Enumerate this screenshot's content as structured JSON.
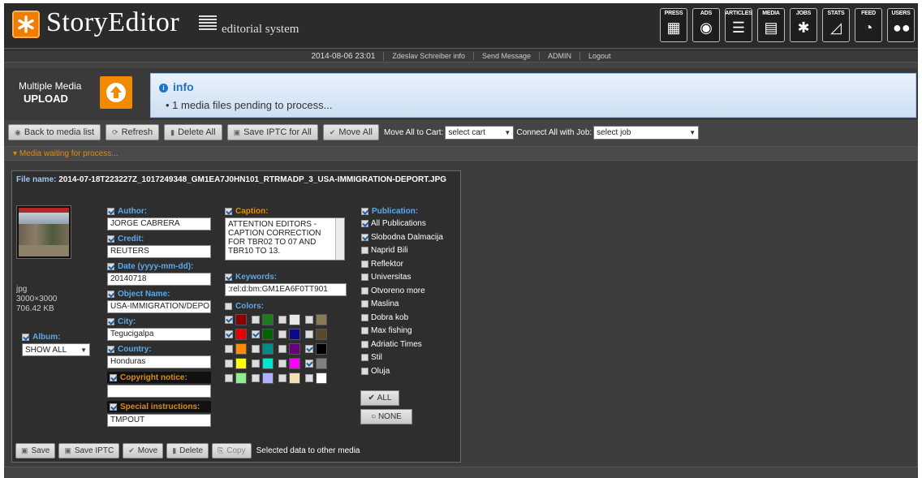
{
  "header": {
    "title": "StoryEditor",
    "subtitle": "editorial system",
    "nav": [
      {
        "label": "PRESS",
        "icon": "grid-icon"
      },
      {
        "label": "ADS",
        "icon": "disc-icon"
      },
      {
        "label": "ARTICLES",
        "icon": "text-lines-icon"
      },
      {
        "label": "MEDIA",
        "icon": "film-icon"
      },
      {
        "label": "JOBS",
        "icon": "sparkle-icon"
      },
      {
        "label": "STATS",
        "icon": "chart-icon"
      },
      {
        "label": "FEED",
        "icon": "rss-icon"
      },
      {
        "label": "USERS",
        "icon": "users-icon"
      }
    ]
  },
  "status": {
    "datetime": "2014-08-06 23:01",
    "user": "Zdeslav Schreiber info",
    "send_message": "Send Message",
    "admin": "ADMIN",
    "logout": "Logout"
  },
  "upload": {
    "line1": "Multiple Media",
    "line2": "UPLOAD"
  },
  "info": {
    "title": "info",
    "message": "• 1 media files pending to process..."
  },
  "toolbar": {
    "back": "Back to media list",
    "refresh": "Refresh",
    "delete_all": "Delete All",
    "save_iptc_all": "Save IPTC for All",
    "move_all": "Move All",
    "move_to_cart_label": "Move All to Cart:",
    "cart_value": "select cart",
    "connect_job_label": "Connect All with Job:",
    "job_value": "select job"
  },
  "panel": {
    "heading": "Media waiting for process..."
  },
  "media": {
    "filename_label": "File name:",
    "filename": "2014-07-18T223227Z_1017249348_GM1EA7J0HN101_RTRMADP_3_USA-IMMIGRATION-DEPORT.JPG",
    "type": "jpg",
    "dimensions": "3000×3000",
    "size": "706.42 KB",
    "album_label": "Album:",
    "album_value": "SHOW ALL",
    "fields": {
      "author_label": "Author:",
      "author": "JORGE CABRERA",
      "credit_label": "Credit:",
      "credit": "REUTERS",
      "date_label": "Date (yyyy-mm-dd):",
      "date": "20140718",
      "object_label": "Object Name:",
      "object": "USA-IMMIGRATION/DEPO",
      "city_label": "City:",
      "city": "Tegucigalpa",
      "country_label": "Country:",
      "country": "Honduras",
      "copyright_label": "Copyright notice:",
      "copyright": "",
      "special_label": "Special instructions:",
      "special": "TMPOUT"
    },
    "caption_label": "Caption:",
    "caption": "ATTENTION EDITORS - CAPTION CORRECTION FOR TBR02 TO 07 AND TBR10 TO 13.",
    "keywords_label": "Keywords:",
    "keywords": ":rel:d:bm:GM1EA6F0TT901",
    "colors_label": "Colors:",
    "colors": [
      [
        "#8b0000",
        "#1e7a1e",
        "#e8e8e8",
        "#8a7a5a"
      ],
      [
        "#e60000",
        "#006400",
        "#0a0a8a",
        "#5a4a2a"
      ],
      [
        "#ff8c00",
        "#008b8b",
        "#6a0080",
        "#000000"
      ],
      [
        "#ffff00",
        "#00e5d0",
        "#ff00ff",
        "#808080"
      ],
      [
        "#90ee90",
        "#b0b0ff",
        "#f5deb3",
        "#ffffff"
      ]
    ],
    "colors_checked": [
      [
        true,
        false,
        false,
        false
      ],
      [
        true,
        true,
        false,
        false
      ],
      [
        false,
        false,
        false,
        true
      ],
      [
        false,
        false,
        false,
        true
      ],
      [
        false,
        false,
        false,
        false
      ]
    ],
    "publication_label": "Publication:",
    "publications": [
      {
        "name": "All Publications",
        "checked": true
      },
      {
        "name": "Slobodna Dalmacija",
        "checked": true
      },
      {
        "name": "Naprid Bili",
        "checked": false
      },
      {
        "name": "Reflektor",
        "checked": false
      },
      {
        "name": "Universitas",
        "checked": false
      },
      {
        "name": "Otvoreno more",
        "checked": false
      },
      {
        "name": "Maslina",
        "checked": false
      },
      {
        "name": "Dobra kob",
        "checked": false
      },
      {
        "name": "Max fishing",
        "checked": false
      },
      {
        "name": "Adriatic Times",
        "checked": false
      },
      {
        "name": "Stil",
        "checked": false
      },
      {
        "name": "Oluja",
        "checked": false
      }
    ],
    "all_button": "ALL",
    "none_button": "NONE"
  },
  "card_tools": {
    "save": "Save",
    "save_iptc": "Save IPTC",
    "move": "Move",
    "delete": "Delete",
    "copy": "Copy",
    "note": "Selected data to other media"
  }
}
